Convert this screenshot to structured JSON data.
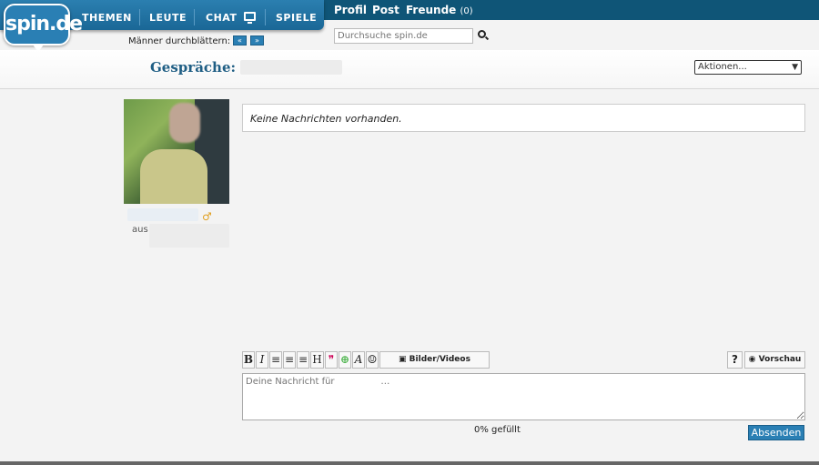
{
  "nav": {
    "logo": "spin.de",
    "themen": "THEMEN",
    "leute": "LEUTE",
    "chat": "CHAT",
    "spiele": "SPIELE",
    "profil": "Profil",
    "post": "Post",
    "freunde": "Freunde",
    "freunde_count": "(0)"
  },
  "browse": {
    "label": "Männer durchblättern:",
    "prev": "«",
    "next": "»"
  },
  "search": {
    "placeholder": "Durchsuche spin.de"
  },
  "header": {
    "title": "Gespräche:",
    "actions_selected": "Aktionen..."
  },
  "profile": {
    "from_label": "aus",
    "gender_symbol": "♂"
  },
  "messages": {
    "empty": "Keine Nachrichten vorhanden."
  },
  "editor": {
    "bold": "B",
    "italic": "I",
    "heading": "H",
    "font": "A",
    "media": "Bilder/Videos",
    "help": "?",
    "preview": "Vorschau",
    "placeholder": "Deine Nachricht für                …",
    "fill_status": "0% gefüllt",
    "send": "Absenden"
  }
}
